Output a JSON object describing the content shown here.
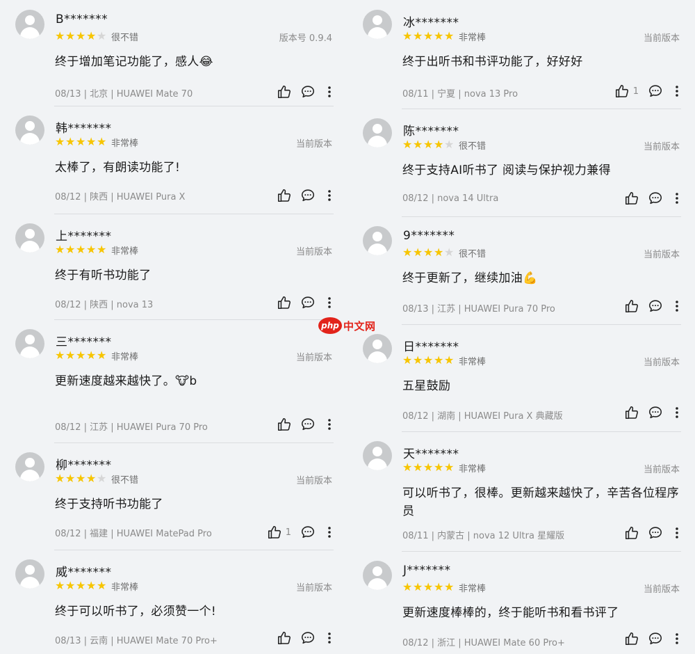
{
  "star_color": "#f7c500",
  "star_empty_color": "#d6d6d6",
  "columns": [
    {
      "reviews": [
        {
          "name": "B*******",
          "stars": 4,
          "rating_text": "很不错",
          "version": "版本号 0.9.4",
          "content": "终于增加笔记功能了，感人😂",
          "footer": "08/13 | 北京 | HUAWEI Mate 70",
          "likes": ""
        },
        {
          "name": "韩*******",
          "stars": 5,
          "rating_text": "非常棒",
          "version": "当前版本",
          "content": "太棒了，有朗读功能了!",
          "footer": "08/12 | 陕西 | HUAWEI Pura X",
          "likes": ""
        },
        {
          "name": "上*******",
          "stars": 5,
          "rating_text": "非常棒",
          "version": "当前版本",
          "content": "终于有听书功能了",
          "footer": "08/12 | 陕西 | nova 13",
          "likes": ""
        },
        {
          "name": "三*******",
          "stars": 5,
          "rating_text": "非常棒",
          "version": "当前版本",
          "content": "更新速度越来越快了。🐮b",
          "footer": "08/12 | 江苏 | HUAWEI Pura 70 Pro",
          "likes": ""
        },
        {
          "name": "柳*******",
          "stars": 4,
          "rating_text": "很不错",
          "version": "当前版本",
          "content": "终于支持听书功能了",
          "footer": "08/12 | 福建 | HUAWEI MatePad Pro",
          "likes": "1"
        },
        {
          "name": "威*******",
          "stars": 5,
          "rating_text": "非常棒",
          "version": "当前版本",
          "content": "终于可以听书了，必须赞一个!",
          "footer": "08/13 | 云南 | HUAWEI Mate 70 Pro+",
          "likes": ""
        }
      ]
    },
    {
      "reviews": [
        {
          "name": "冰*******",
          "stars": 5,
          "rating_text": "非常棒",
          "version": "当前版本",
          "content": "终于出听书和书评功能了，好好好",
          "footer": "08/11 | 宁夏 | nova 13 Pro",
          "likes": "1"
        },
        {
          "name": "陈*******",
          "stars": 4,
          "rating_text": "很不错",
          "version": "当前版本",
          "content": "终于支持AI听书了 阅读与保护视力兼得",
          "footer": "08/12 | nova 14 Ultra",
          "likes": ""
        },
        {
          "name": "9*******",
          "stars": 4,
          "rating_text": "很不错",
          "version": "当前版本",
          "content": "终于更新了，继续加油💪",
          "footer": "08/13 | 江苏 | HUAWEI Pura 70 Pro",
          "likes": ""
        },
        {
          "name": "日*******",
          "stars": 5,
          "rating_text": "非常棒",
          "version": "当前版本",
          "content": "五星鼓励",
          "footer": "08/12 | 湖南 | HUAWEI Pura X 典藏版",
          "likes": ""
        },
        {
          "name": "天*******",
          "stars": 5,
          "rating_text": "非常棒",
          "version": "当前版本",
          "content": "可以听书了，很棒。更新越来越快了，辛苦各位程序员",
          "footer": "08/11 | 内蒙古 | nova 12 Ultra 星耀版",
          "likes": ""
        },
        {
          "name": "J*******",
          "stars": 5,
          "rating_text": "非常棒",
          "version": "当前版本",
          "content": "更新速度棒棒的，终于能听书和看书评了",
          "footer": "08/12 | 浙江 | HUAWEI Mate 60 Pro+",
          "likes": ""
        }
      ]
    }
  ],
  "watermark": {
    "logo": "php",
    "text": "中文网"
  }
}
